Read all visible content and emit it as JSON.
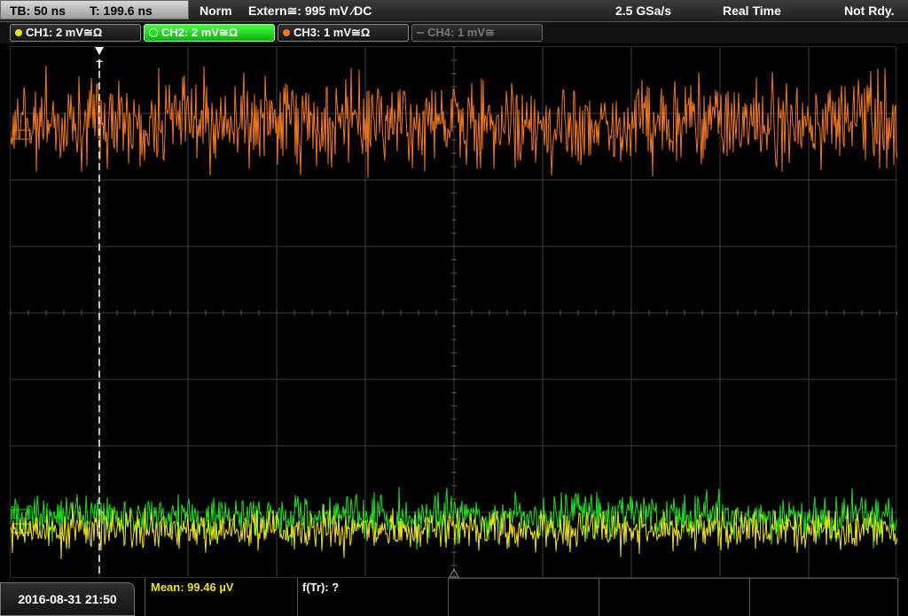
{
  "top": {
    "timebase": "TB: 50 ns",
    "trigger_time": "T: 199.6 ns",
    "mode": "Norm",
    "trigger_source": "Extern≅: 995 mV ∕DC",
    "sample_rate": "2.5 GSa/s",
    "acq_mode": "Real Time",
    "status": "Not Rdy."
  },
  "channels": [
    {
      "label": "CH1: 2 mV≅Ω",
      "color": "#f0e020",
      "active": false,
      "enabled": true
    },
    {
      "label": "CH2: 2 mV≅Ω",
      "color": "#1ee01e",
      "active": true,
      "enabled": true
    },
    {
      "label": "CH3: 1 mV≅Ω",
      "color": "#f07820",
      "active": false,
      "enabled": true
    },
    {
      "label": "CH4: 1 mV≅",
      "color": "#888888",
      "active": false,
      "enabled": false
    }
  ],
  "trigger_marker": "T",
  "bottom": {
    "datetime": "2016-08-31 21:50",
    "measurement1": "Mean: 99.46 µV",
    "measurement2": "f(Tr): ?"
  },
  "colors": {
    "ch1": "#f0e020",
    "ch2": "#1ee01e",
    "ch3": "#f07820",
    "grid": "#3c3c3c"
  }
}
